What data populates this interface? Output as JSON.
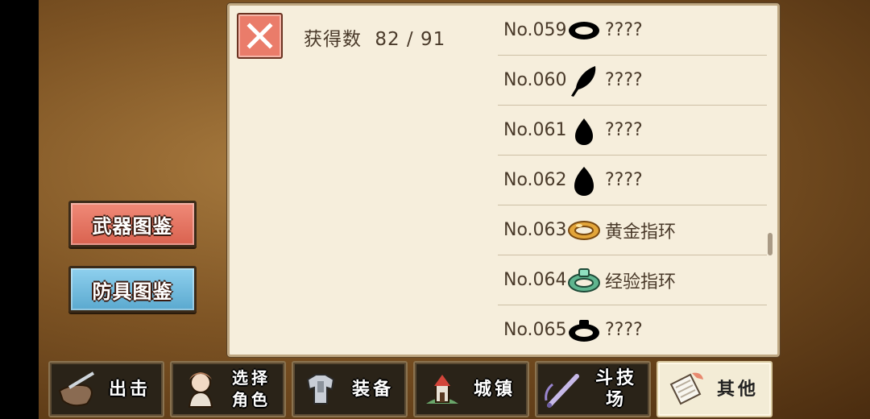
{
  "sidebar": {
    "weapon_book": "武器图鉴",
    "armor_book": "防具图鉴"
  },
  "panel": {
    "count_label": "获得数",
    "count_value": "82 / 91",
    "items": [
      {
        "no": "No.059",
        "name": "????",
        "icon": "ring-silhouette"
      },
      {
        "no": "No.060",
        "name": "????",
        "icon": "feather-silhouette"
      },
      {
        "no": "No.061",
        "name": "????",
        "icon": "drop-silhouette"
      },
      {
        "no": "No.062",
        "name": "????",
        "icon": "drop-silhouette"
      },
      {
        "no": "No.063",
        "name": "黄金指环",
        "icon": "gold-ring"
      },
      {
        "no": "No.064",
        "name": "经验指环",
        "icon": "experience-ring"
      },
      {
        "no": "No.065",
        "name": "????",
        "icon": "ring-silhouette"
      }
    ]
  },
  "nav": {
    "sortie": "出击",
    "select_character_line1": "选择",
    "select_character_line2": "角色",
    "equipment": "装备",
    "town": "城镇",
    "arena": "斗技场",
    "other": "其他"
  }
}
